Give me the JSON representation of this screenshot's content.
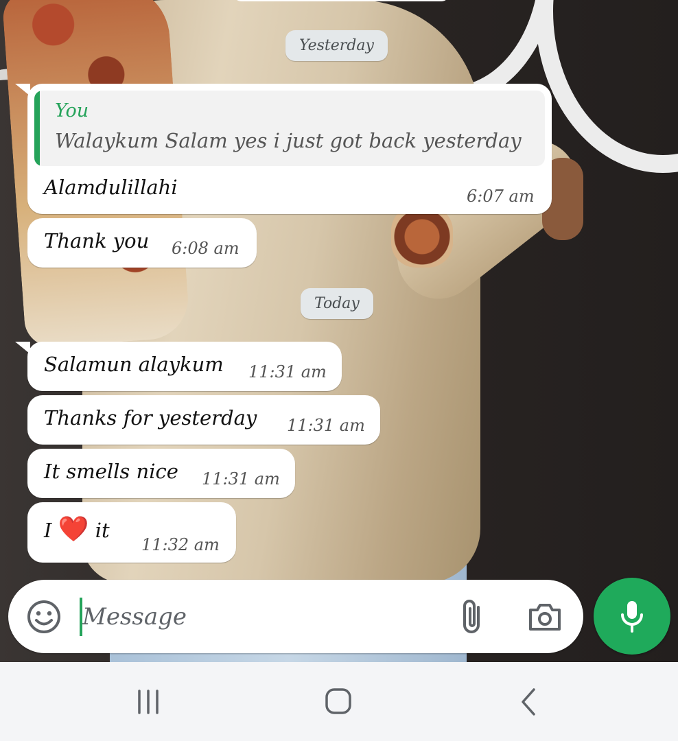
{
  "chat": {
    "date_yesterday": "Yesterday",
    "date_today": "Today",
    "messages": [
      {
        "quote_author": "You",
        "quote_text": "Walaykum Salam yes i just got back yesterday",
        "text": "Alamdulillahi",
        "time": "6:07 am"
      },
      {
        "text": "Thank you",
        "time": "6:08 am"
      },
      {
        "text": "Salamun alaykum",
        "time": "11:31 am"
      },
      {
        "text": "Thanks for yesterday",
        "time": "11:31 am"
      },
      {
        "text": "It smells nice",
        "time": "11:31 am"
      },
      {
        "text_before": "I",
        "emoji": "❤️",
        "text_after": "it",
        "time": "11:32 am"
      }
    ]
  },
  "composer": {
    "placeholder": "Message",
    "icons": [
      "emoji-icon",
      "paperclip-icon",
      "camera-icon",
      "microphone-icon"
    ]
  },
  "nav": {
    "icons": [
      "recent-apps-icon",
      "home-icon",
      "back-icon"
    ]
  },
  "colors": {
    "accent_green": "#1faa5b",
    "bubble": "#ffffff",
    "date_pill": "#e4e8ea"
  }
}
